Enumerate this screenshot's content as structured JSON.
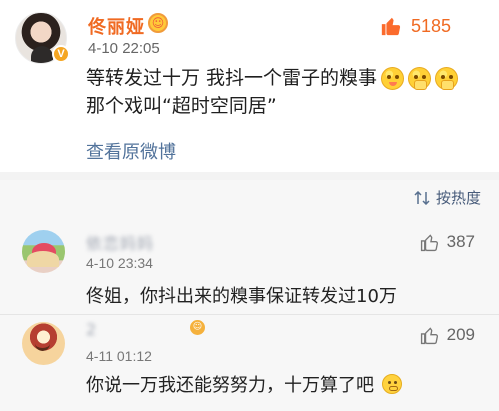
{
  "post": {
    "author": "佟丽娅",
    "verified_symbol": "V",
    "badge_symbol": "☺",
    "time": "4-10 22:05",
    "likes": "5185",
    "text_line_1": "等转发过十万 我抖一个雷子的糗事",
    "text_line_2": "那个戏叫“超时空同居”",
    "view_original": "查看原微博",
    "emoji_icons": [
      "tongue-out-face-icon",
      "shy-hand-face-icon",
      "shy-hand-face-icon"
    ]
  },
  "comments_section": {
    "sort_label": "按热度",
    "comments": [
      {
        "name": "依恋妈妈",
        "time": "4-10 23:34",
        "likes": "387",
        "text": "佟姐，你抖出来的糗事保证转发过10万"
      },
      {
        "name": "2",
        "time": "4-11 01:12",
        "likes": "209",
        "text": "你说一万我还能努努力，十万算了吧",
        "badge_symbol": "☺",
        "emoji_icon": "squint-face-icon"
      }
    ]
  },
  "colors": {
    "accent_orange": "#f06a22",
    "link_blue": "#52739b",
    "background_gray": "#f7f7f7"
  }
}
